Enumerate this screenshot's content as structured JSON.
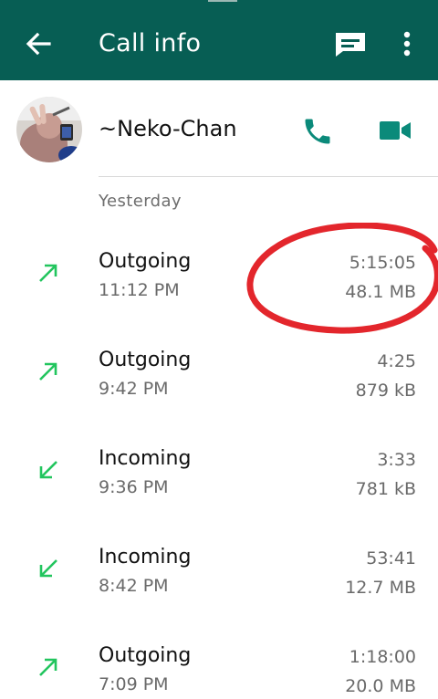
{
  "app_bar": {
    "title": "Call info",
    "back_icon": "arrow-back-icon",
    "message_icon": "message-icon",
    "more_icon": "more-vert-icon",
    "color": "#075e54"
  },
  "contact": {
    "name": "~Neko-Chan",
    "call_icon": "phone-icon",
    "video_icon": "videocam-icon",
    "accent": "#0b8a7a"
  },
  "section_label": "Yesterday",
  "calls": [
    {
      "type": "Outgoing",
      "time": "11:12 PM",
      "duration": "5:15:05",
      "size": "48.1 MB",
      "direction": "outgoing"
    },
    {
      "type": "Outgoing",
      "time": "9:42 PM",
      "duration": "4:25",
      "size": "879 kB",
      "direction": "outgoing"
    },
    {
      "type": "Incoming",
      "time": "9:36 PM",
      "duration": "3:33",
      "size": "781 kB",
      "direction": "incoming"
    },
    {
      "type": "Incoming",
      "time": "8:42 PM",
      "duration": "53:41",
      "size": "12.7 MB",
      "direction": "incoming"
    },
    {
      "type": "Outgoing",
      "time": "7:09 PM",
      "duration": "1:18:00",
      "size": "20.0 MB",
      "direction": "outgoing"
    }
  ],
  "colors": {
    "arrow_green": "#22c55e",
    "annotation_red": "#e3262c"
  }
}
